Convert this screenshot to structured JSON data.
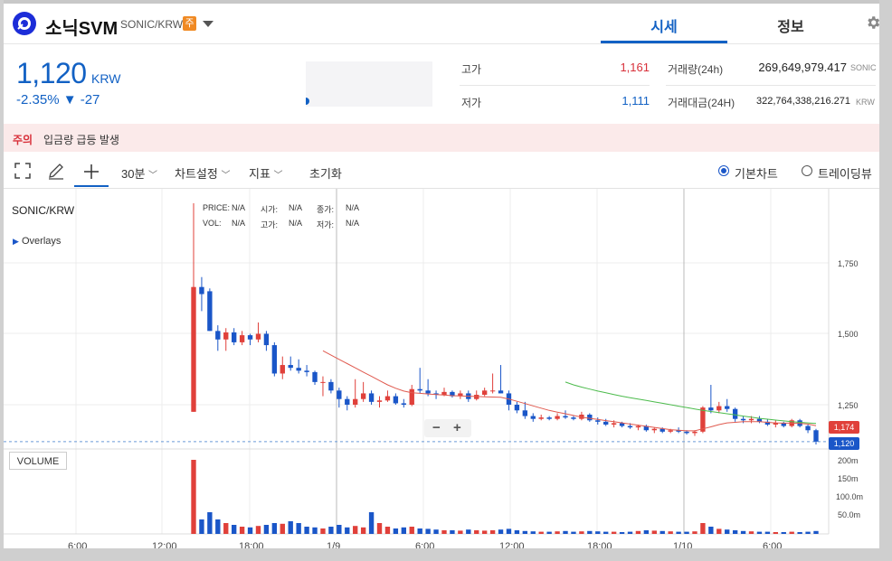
{
  "header": {
    "coin_name": "소닉SVM",
    "pair": "SONIC/KRW",
    "badge": "주",
    "tabs": [
      "시세",
      "정보"
    ]
  },
  "summary": {
    "price": "1,120",
    "unit": "KRW",
    "change_pct": "-2.35%",
    "change_abs": "▼ -27",
    "high_label": "고가",
    "high_value": "1,161",
    "low_label": "저가",
    "low_value": "1,111",
    "volume_label": "거래량(24h)",
    "volume_value": "269,649,979.417",
    "volume_unit": "SONIC",
    "amount_label": "거래대금(24H)",
    "amount_value": "322,764,338,216.271",
    "amount_unit": "KRW"
  },
  "notice": {
    "tag": "주의",
    "text": "입금량 급등 발생"
  },
  "toolbar": {
    "interval": "30분",
    "chart_settings": "차트설정",
    "indicators": "지표",
    "reset": "초기화",
    "view_basic": "기본차트",
    "view_tradingview": "트레이딩뷰"
  },
  "chart": {
    "pair_label": "SONIC/KRW",
    "overlays_label": "Overlays",
    "info": {
      "price_label": "PRICE:",
      "vol_label": "VOL:",
      "open_label": "시가:",
      "high_label": "고가:",
      "close_label": "종가:",
      "low_label": "저가:",
      "na": "N/A"
    },
    "volume_label": "VOLUME",
    "last_price_tag": "1,120",
    "ma_tag": "1,174"
  },
  "chart_data": {
    "type": "candlestick",
    "price_ticks": [
      "1,750",
      "1,500",
      "1,250"
    ],
    "volume_ticks": [
      "200m",
      "150m",
      "100.0m",
      "50.0m"
    ],
    "time_ticks": [
      "6:00",
      "12:00",
      "18:00",
      "1/9",
      "6:00",
      "12:00",
      "18:00",
      "1/10",
      "6:00"
    ],
    "ylim": [
      1080,
      2000
    ],
    "candles": [
      {
        "o": 1225,
        "h": 1960,
        "l": 1225,
        "c": 1665,
        "v": 205
      },
      {
        "o": 1665,
        "h": 1700,
        "l": 1580,
        "c": 1640,
        "v": 40
      },
      {
        "o": 1650,
        "h": 1660,
        "l": 1510,
        "c": 1510,
        "v": 60
      },
      {
        "o": 1510,
        "h": 1530,
        "l": 1440,
        "c": 1480,
        "v": 40
      },
      {
        "o": 1480,
        "h": 1520,
        "l": 1440,
        "c": 1505,
        "v": 30
      },
      {
        "o": 1505,
        "h": 1520,
        "l": 1460,
        "c": 1470,
        "v": 25
      },
      {
        "o": 1470,
        "h": 1510,
        "l": 1460,
        "c": 1495,
        "v": 20
      },
      {
        "o": 1495,
        "h": 1500,
        "l": 1460,
        "c": 1480,
        "v": 18
      },
      {
        "o": 1480,
        "h": 1540,
        "l": 1470,
        "c": 1500,
        "v": 22
      },
      {
        "o": 1500,
        "h": 1510,
        "l": 1440,
        "c": 1460,
        "v": 25
      },
      {
        "o": 1460,
        "h": 1470,
        "l": 1350,
        "c": 1360,
        "v": 30
      },
      {
        "o": 1360,
        "h": 1420,
        "l": 1340,
        "c": 1390,
        "v": 28
      },
      {
        "o": 1390,
        "h": 1420,
        "l": 1370,
        "c": 1380,
        "v": 35
      },
      {
        "o": 1380,
        "h": 1410,
        "l": 1360,
        "c": 1370,
        "v": 30
      },
      {
        "o": 1370,
        "h": 1390,
        "l": 1350,
        "c": 1365,
        "v": 20
      },
      {
        "o": 1365,
        "h": 1370,
        "l": 1320,
        "c": 1330,
        "v": 18
      },
      {
        "o": 1330,
        "h": 1350,
        "l": 1280,
        "c": 1330,
        "v": 15
      },
      {
        "o": 1330,
        "h": 1340,
        "l": 1290,
        "c": 1300,
        "v": 20
      },
      {
        "o": 1300,
        "h": 1310,
        "l": 1240,
        "c": 1270,
        "v": 25
      },
      {
        "o": 1270,
        "h": 1280,
        "l": 1230,
        "c": 1250,
        "v": 18
      },
      {
        "o": 1250,
        "h": 1340,
        "l": 1240,
        "c": 1270,
        "v": 22
      },
      {
        "o": 1270,
        "h": 1330,
        "l": 1260,
        "c": 1290,
        "v": 18
      },
      {
        "o": 1290,
        "h": 1300,
        "l": 1250,
        "c": 1260,
        "v": 60
      },
      {
        "o": 1260,
        "h": 1280,
        "l": 1240,
        "c": 1265,
        "v": 30
      },
      {
        "o": 1265,
        "h": 1300,
        "l": 1260,
        "c": 1280,
        "v": 20
      },
      {
        "o": 1280,
        "h": 1290,
        "l": 1250,
        "c": 1255,
        "v": 15
      },
      {
        "o": 1255,
        "h": 1270,
        "l": 1240,
        "c": 1250,
        "v": 18
      },
      {
        "o": 1250,
        "h": 1320,
        "l": 1245,
        "c": 1305,
        "v": 20
      },
      {
        "o": 1305,
        "h": 1380,
        "l": 1290,
        "c": 1300,
        "v": 15
      },
      {
        "o": 1300,
        "h": 1340,
        "l": 1280,
        "c": 1290,
        "v": 14
      },
      {
        "o": 1290,
        "h": 1300,
        "l": 1270,
        "c": 1285,
        "v": 12
      },
      {
        "o": 1285,
        "h": 1310,
        "l": 1280,
        "c": 1295,
        "v": 10
      },
      {
        "o": 1295,
        "h": 1300,
        "l": 1275,
        "c": 1280,
        "v": 10
      },
      {
        "o": 1280,
        "h": 1300,
        "l": 1270,
        "c": 1290,
        "v": 9
      },
      {
        "o": 1290,
        "h": 1300,
        "l": 1260,
        "c": 1270,
        "v": 12
      },
      {
        "o": 1270,
        "h": 1300,
        "l": 1265,
        "c": 1285,
        "v": 10
      },
      {
        "o": 1285,
        "h": 1310,
        "l": 1280,
        "c": 1300,
        "v": 9
      },
      {
        "o": 1300,
        "h": 1360,
        "l": 1290,
        "c": 1300,
        "v": 10
      },
      {
        "o": 1300,
        "h": 1390,
        "l": 1290,
        "c": 1290,
        "v": 12
      },
      {
        "o": 1290,
        "h": 1300,
        "l": 1230,
        "c": 1250,
        "v": 14
      },
      {
        "o": 1250,
        "h": 1260,
        "l": 1220,
        "c": 1230,
        "v": 10
      },
      {
        "o": 1230,
        "h": 1260,
        "l": 1200,
        "c": 1210,
        "v": 8
      },
      {
        "o": 1210,
        "h": 1220,
        "l": 1190,
        "c": 1200,
        "v": 7
      },
      {
        "o": 1200,
        "h": 1215,
        "l": 1195,
        "c": 1205,
        "v": 6
      },
      {
        "o": 1205,
        "h": 1210,
        "l": 1195,
        "c": 1200,
        "v": 6
      },
      {
        "o": 1200,
        "h": 1220,
        "l": 1195,
        "c": 1210,
        "v": 7
      },
      {
        "o": 1210,
        "h": 1230,
        "l": 1200,
        "c": 1205,
        "v": 8
      },
      {
        "o": 1205,
        "h": 1210,
        "l": 1195,
        "c": 1200,
        "v": 6
      },
      {
        "o": 1200,
        "h": 1225,
        "l": 1195,
        "c": 1215,
        "v": 7
      },
      {
        "o": 1215,
        "h": 1220,
        "l": 1190,
        "c": 1195,
        "v": 8
      },
      {
        "o": 1195,
        "h": 1205,
        "l": 1180,
        "c": 1190,
        "v": 7
      },
      {
        "o": 1190,
        "h": 1200,
        "l": 1175,
        "c": 1180,
        "v": 6
      },
      {
        "o": 1180,
        "h": 1195,
        "l": 1170,
        "c": 1185,
        "v": 6
      },
      {
        "o": 1185,
        "h": 1190,
        "l": 1170,
        "c": 1175,
        "v": 5
      },
      {
        "o": 1175,
        "h": 1185,
        "l": 1165,
        "c": 1170,
        "v": 6
      },
      {
        "o": 1170,
        "h": 1180,
        "l": 1160,
        "c": 1175,
        "v": 8
      },
      {
        "o": 1175,
        "h": 1180,
        "l": 1155,
        "c": 1160,
        "v": 10
      },
      {
        "o": 1160,
        "h": 1170,
        "l": 1150,
        "c": 1165,
        "v": 9
      },
      {
        "o": 1165,
        "h": 1170,
        "l": 1150,
        "c": 1155,
        "v": 8
      },
      {
        "o": 1155,
        "h": 1165,
        "l": 1150,
        "c": 1160,
        "v": 7
      },
      {
        "o": 1160,
        "h": 1170,
        "l": 1150,
        "c": 1155,
        "v": 6
      },
      {
        "o": 1155,
        "h": 1160,
        "l": 1145,
        "c": 1150,
        "v": 6
      },
      {
        "o": 1150,
        "h": 1160,
        "l": 1140,
        "c": 1155,
        "v": 7
      },
      {
        "o": 1155,
        "h": 1245,
        "l": 1150,
        "c": 1240,
        "v": 30
      },
      {
        "o": 1240,
        "h": 1320,
        "l": 1220,
        "c": 1230,
        "v": 20
      },
      {
        "o": 1230,
        "h": 1260,
        "l": 1220,
        "c": 1245,
        "v": 14
      },
      {
        "o": 1245,
        "h": 1270,
        "l": 1225,
        "c": 1235,
        "v": 12
      },
      {
        "o": 1235,
        "h": 1240,
        "l": 1190,
        "c": 1200,
        "v": 10
      },
      {
        "o": 1200,
        "h": 1210,
        "l": 1185,
        "c": 1195,
        "v": 8
      },
      {
        "o": 1195,
        "h": 1210,
        "l": 1185,
        "c": 1200,
        "v": 7
      },
      {
        "o": 1200,
        "h": 1210,
        "l": 1185,
        "c": 1190,
        "v": 6
      },
      {
        "o": 1190,
        "h": 1200,
        "l": 1175,
        "c": 1180,
        "v": 6
      },
      {
        "o": 1180,
        "h": 1195,
        "l": 1170,
        "c": 1185,
        "v": 5
      },
      {
        "o": 1185,
        "h": 1190,
        "l": 1170,
        "c": 1175,
        "v": 5
      },
      {
        "o": 1175,
        "h": 1200,
        "l": 1170,
        "c": 1195,
        "v": 6
      },
      {
        "o": 1195,
        "h": 1200,
        "l": 1170,
        "c": 1175,
        "v": 5
      },
      {
        "o": 1175,
        "h": 1180,
        "l": 1150,
        "c": 1160,
        "v": 6
      },
      {
        "o": 1160,
        "h": 1165,
        "l": 1110,
        "c": 1120,
        "v": 8
      }
    ],
    "ma_long": [
      null,
      null,
      null,
      null,
      null,
      null,
      null,
      null,
      null,
      null,
      null,
      null,
      null,
      null,
      null,
      null,
      null,
      null,
      null,
      null,
      null,
      null,
      null,
      null,
      null,
      null,
      null,
      null,
      null,
      null,
      null,
      null,
      null,
      null,
      null,
      null,
      null,
      null,
      null,
      null,
      null,
      null,
      null,
      null,
      null,
      null,
      1330,
      1320,
      1312,
      1305,
      1298,
      1292,
      1286,
      1280,
      1275,
      1270,
      1265,
      1260,
      1255,
      1250,
      1245,
      1240,
      1235,
      1230,
      1226,
      1222,
      1218,
      1214,
      1210,
      1206,
      1202,
      1199,
      1196,
      1193,
      1190,
      1188,
      1186,
      1184
    ],
    "ma_short": [
      null,
      null,
      null,
      null,
      null,
      null,
      null,
      null,
      null,
      null,
      null,
      null,
      null,
      null,
      null,
      null,
      1440,
      1425,
      1410,
      1395,
      1380,
      1365,
      1350,
      1335,
      1320,
      1308,
      1298,
      1292,
      1290,
      1288,
      1286,
      1284,
      1282,
      1281,
      1280,
      1279,
      1278,
      1277,
      1276,
      1270,
      1262,
      1254,
      1246,
      1238,
      1230,
      1224,
      1218,
      1212,
      1206,
      1202,
      1198,
      1194,
      1190,
      1186,
      1182,
      1178,
      1174,
      1170,
      1166,
      1162,
      1160,
      1158,
      1158,
      1165,
      1172,
      1180,
      1186,
      1188,
      1190,
      1190,
      1190,
      1188,
      1186,
      1185,
      1185,
      1184,
      1182,
      1176
    ]
  }
}
